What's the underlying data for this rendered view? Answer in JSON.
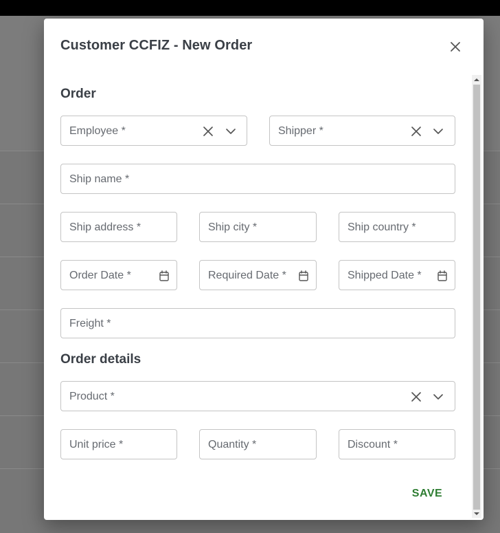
{
  "dialog": {
    "title": "Customer CCFIZ - New Order",
    "save_label": "SAVE"
  },
  "sections": {
    "order": "Order",
    "details": "Order details"
  },
  "fields": {
    "employee": "Employee *",
    "shipper": "Shipper *",
    "ship_name": "Ship name *",
    "ship_address": "Ship address *",
    "ship_city": "Ship city *",
    "ship_country": "Ship country *",
    "order_date": "Order Date *",
    "required_date": "Required Date *",
    "shipped_date": "Shipped Date *",
    "freight": "Freight *",
    "product": "Product *",
    "unit_price": "Unit price *",
    "quantity": "Quantity *",
    "discount": "Discount *"
  },
  "icons": {
    "close": "close-icon",
    "clear": "clear-icon",
    "dropdown": "chevron-down-icon",
    "calendar": "calendar-icon"
  },
  "colors": {
    "save": "#2e7d32",
    "title": "#3a3f46",
    "border": "#c4c4c4",
    "overlay": "#777777"
  }
}
